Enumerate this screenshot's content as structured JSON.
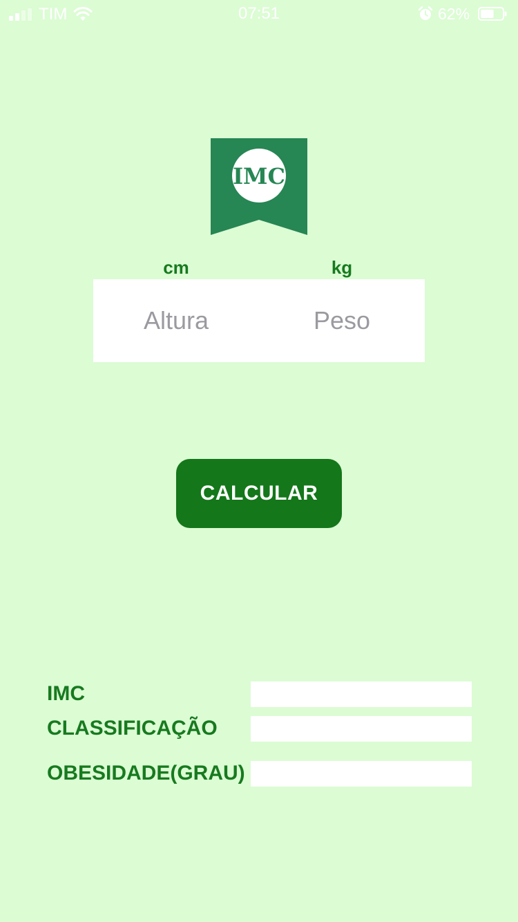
{
  "status_bar": {
    "carrier": "TIM",
    "time": "07:51",
    "battery_percent": "62%",
    "battery_level": 0.62,
    "icons": [
      "signal-icon",
      "wifi-icon",
      "alarm-icon",
      "battery-icon"
    ]
  },
  "logo": {
    "text": "IMC",
    "color": "#268654"
  },
  "inputs": {
    "height_unit": "cm",
    "weight_unit": "kg",
    "height_placeholder": "Altura",
    "weight_placeholder": "Peso",
    "height_value": "",
    "weight_value": ""
  },
  "actions": {
    "calculate_label": "CALCULAR"
  },
  "results": {
    "imc_label": "IMC",
    "imc_value": "",
    "classification_label": "CLASSIFICAÇÃO",
    "classification_value": "",
    "obesity_label": "OBESIDADE(GRAU)",
    "obesity_value": ""
  },
  "colors": {
    "background": "#dcfcd4",
    "accent": "#177a1f",
    "button": "#14771a",
    "logo": "#268654"
  }
}
